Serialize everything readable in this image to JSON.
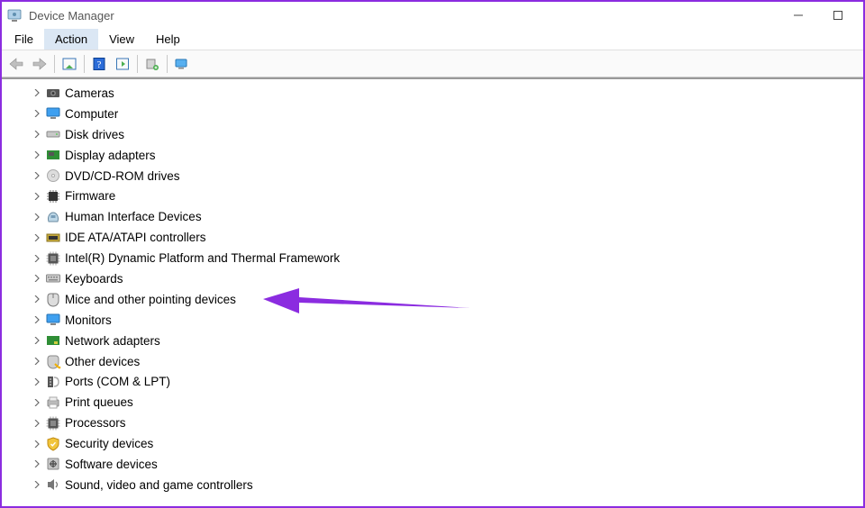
{
  "window": {
    "title": "Device Manager"
  },
  "menubar": {
    "items": [
      {
        "label": "File"
      },
      {
        "label": "Action"
      },
      {
        "label": "View"
      },
      {
        "label": "Help"
      }
    ],
    "activeIndex": 1
  },
  "tree": {
    "items": [
      {
        "label": "Cameras",
        "icon": "camera"
      },
      {
        "label": "Computer",
        "icon": "monitor"
      },
      {
        "label": "Disk drives",
        "icon": "disk"
      },
      {
        "label": "Display adapters",
        "icon": "pcb"
      },
      {
        "label": "DVD/CD-ROM drives",
        "icon": "disc"
      },
      {
        "label": "Firmware",
        "icon": "chip"
      },
      {
        "label": "Human Interface Devices",
        "icon": "hid"
      },
      {
        "label": "IDE ATA/ATAPI controllers",
        "icon": "ide"
      },
      {
        "label": "Intel(R) Dynamic Platform and Thermal Framework",
        "icon": "cpu"
      },
      {
        "label": "Keyboards",
        "icon": "keyboard"
      },
      {
        "label": "Mice and other pointing devices",
        "icon": "mouse"
      },
      {
        "label": "Monitors",
        "icon": "monitor"
      },
      {
        "label": "Network adapters",
        "icon": "nic"
      },
      {
        "label": "Other devices",
        "icon": "other"
      },
      {
        "label": "Ports (COM & LPT)",
        "icon": "port"
      },
      {
        "label": "Print queues",
        "icon": "printer"
      },
      {
        "label": "Processors",
        "icon": "cpu"
      },
      {
        "label": "Security devices",
        "icon": "shield"
      },
      {
        "label": "Software devices",
        "icon": "software"
      },
      {
        "label": "Sound, video and game controllers",
        "icon": "speaker"
      }
    ]
  },
  "annotation": {
    "highlightIndex": 10,
    "color": "#8b2ce0"
  }
}
